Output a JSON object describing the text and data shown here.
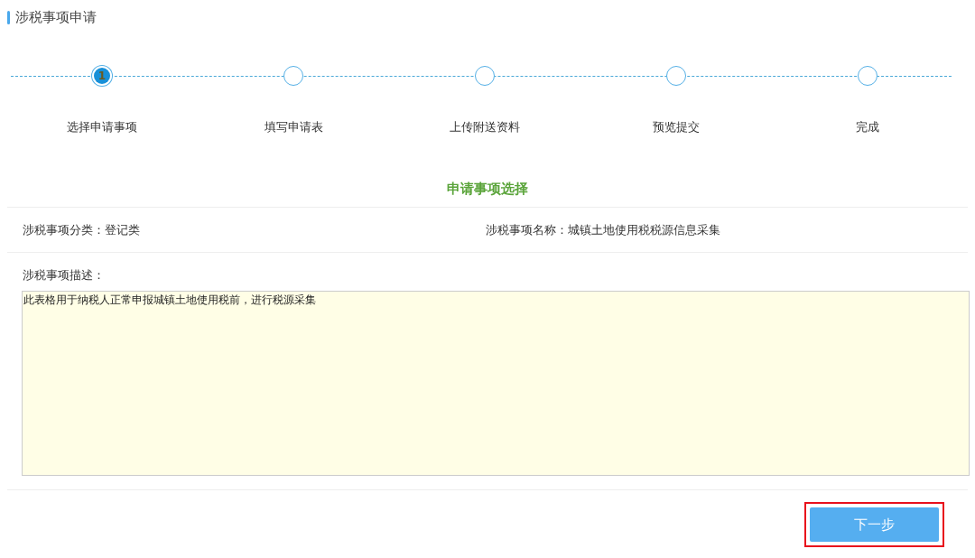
{
  "page_title": "涉税事项申请",
  "steps": [
    {
      "label": "选择申请事项",
      "selected": true,
      "number": "1"
    },
    {
      "label": "填写申请表",
      "selected": false
    },
    {
      "label": "上传附送资料",
      "selected": false
    },
    {
      "label": "预览提交",
      "selected": false
    },
    {
      "label": "完成",
      "selected": false
    }
  ],
  "section_title": "申请事项选择",
  "category": "涉税事项分类：登记类",
  "item_name": "涉税事项名称：城镇土地使用税税源信息采集",
  "description_label": "涉税事项描述：",
  "description": "此表格用于纳税人正常申报城镇土地使用税前，进行税源采集",
  "next_button": {
    "label": "下一步",
    "highlighted": true
  }
}
